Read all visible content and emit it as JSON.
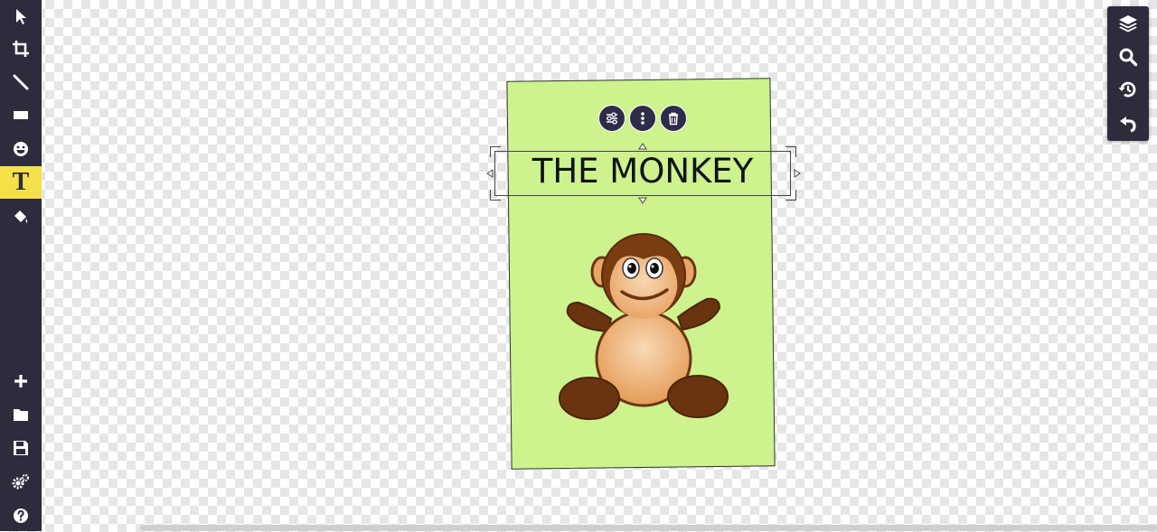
{
  "canvas": {
    "card": {
      "title": "THE MONKEY",
      "background_color": "#cdf28e",
      "illustration": "monkey-illustration"
    },
    "selection_actions": [
      {
        "icon": "sliders-icon",
        "name": "adjust-button"
      },
      {
        "icon": "more-vertical-icon",
        "name": "more-options-button"
      },
      {
        "icon": "trash-icon",
        "name": "delete-button"
      }
    ]
  },
  "left_toolbar": {
    "tools": [
      "select",
      "crop",
      "draw",
      "rectangle",
      "sticker",
      "text",
      "fill"
    ],
    "active_tool": "text",
    "text_tool_label": "T",
    "bottom_tools": [
      "add",
      "open",
      "save",
      "settings",
      "help"
    ],
    "active_color": "#f5e04a"
  },
  "right_toolbar": {
    "tools": [
      "layers",
      "zoom",
      "history",
      "undo"
    ]
  },
  "colors": {
    "toolbar_bg": "#2c2c3d",
    "accent": "#f5e04a",
    "monkey_brown": "#6b3410",
    "monkey_tan": "#e8a86a"
  }
}
